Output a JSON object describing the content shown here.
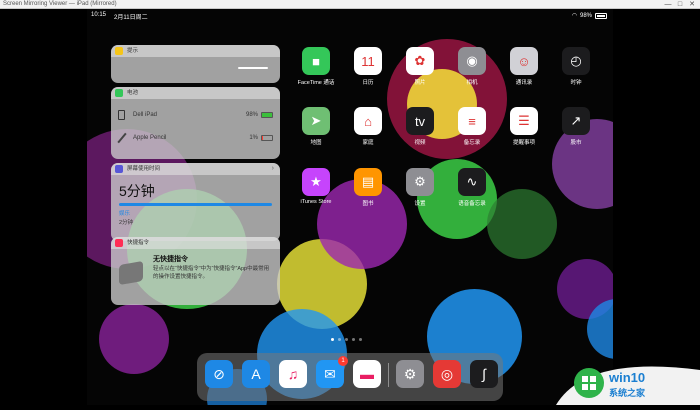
{
  "window": {
    "title": "Screen Mirroring Viewer — iPad (Mirrored)",
    "minimize": "—",
    "maximize": "□",
    "close": "✕"
  },
  "status": {
    "time": "10:15",
    "date": "2月11日周二",
    "battery": "98%"
  },
  "widgets": {
    "tips": {
      "title": "提示"
    },
    "battery": {
      "title": "电池",
      "rows": [
        {
          "name": "Dell iPad",
          "pct": "98%",
          "level": 0.98
        },
        {
          "name": "Apple Pencil",
          "pct": "1%",
          "level": 0.01
        }
      ]
    },
    "screentime": {
      "title": "屏幕使用时间",
      "value": "5分钟",
      "sub1": "娱乐",
      "sub2": "2分钟"
    },
    "shortcuts": {
      "title": "快捷指令",
      "name": "无快捷指令",
      "desc": "轻点以在“快捷指令”中为“快捷指令”App中最常用的操作设置快捷指令。"
    }
  },
  "apps": [
    {
      "name": "FaceTime 通话",
      "icon": "facetime-icon",
      "glyph": "■",
      "bg": "#34c759"
    },
    {
      "name": "日历",
      "icon": "calendar-icon",
      "glyph": "11",
      "bg": "#ffffff"
    },
    {
      "name": "照片",
      "icon": "photos-icon",
      "glyph": "✿",
      "bg": "#ffffff"
    },
    {
      "name": "相机",
      "icon": "camera-icon",
      "glyph": "◉",
      "bg": "#8e8e93"
    },
    {
      "name": "通讯录",
      "icon": "contacts-icon",
      "glyph": "☺",
      "bg": "#d1d1d6"
    },
    {
      "name": "时钟",
      "icon": "clock-icon",
      "glyph": "◴",
      "bg": "#1c1c1e"
    },
    {
      "name": "地图",
      "icon": "maps-icon",
      "glyph": "➤",
      "bg": "#6fbf73"
    },
    {
      "name": "家庭",
      "icon": "home-icon",
      "glyph": "⌂",
      "bg": "#ffffff"
    },
    {
      "name": "视频",
      "icon": "tv-icon",
      "glyph": "tv",
      "bg": "#1c1c1e"
    },
    {
      "name": "备忘录",
      "icon": "notes-icon",
      "glyph": "≡",
      "bg": "#ffffff"
    },
    {
      "name": "提醒事项",
      "icon": "reminders-icon",
      "glyph": "☰",
      "bg": "#ffffff"
    },
    {
      "name": "股市",
      "icon": "stocks-icon",
      "glyph": "↗",
      "bg": "#1c1c1e"
    },
    {
      "name": "iTunes Store",
      "icon": "itunes-store-icon",
      "glyph": "★",
      "bg": "#c644fc"
    },
    {
      "name": "图书",
      "icon": "books-icon",
      "glyph": "▤",
      "bg": "#ff9500"
    },
    {
      "name": "设置",
      "icon": "settings-icon",
      "glyph": "⚙",
      "bg": "#8e8e93"
    },
    {
      "name": "语音备忘录",
      "icon": "voice-memos-icon",
      "glyph": "∿",
      "bg": "#1c1c1e"
    }
  ],
  "dock": [
    {
      "icon": "safari-icon",
      "glyph": "⊘",
      "bg": "#1e88e5"
    },
    {
      "icon": "app-store-icon",
      "glyph": "A",
      "bg": "#1e88e5"
    },
    {
      "icon": "music-icon",
      "glyph": "♫",
      "bg": "#ffffff"
    },
    {
      "icon": "mail-icon",
      "glyph": "✉",
      "bg": "#2196f3",
      "badge": "1"
    },
    {
      "icon": "files-icon",
      "glyph": "▬",
      "bg": "#ffffff"
    },
    {
      "icon": "settings-icon",
      "glyph": "⚙",
      "bg": "#8e8e93"
    },
    {
      "icon": "netease-music-icon",
      "glyph": "◎",
      "bg": "#e53935"
    },
    {
      "icon": "procreate-icon",
      "glyph": "∫",
      "bg": "#1c1c1e"
    }
  ],
  "page_indicator": {
    "count": 5,
    "current": 0
  },
  "watermark": {
    "brand": "win10",
    "sub": "系统之家",
    "accent": "#2fb34a"
  }
}
